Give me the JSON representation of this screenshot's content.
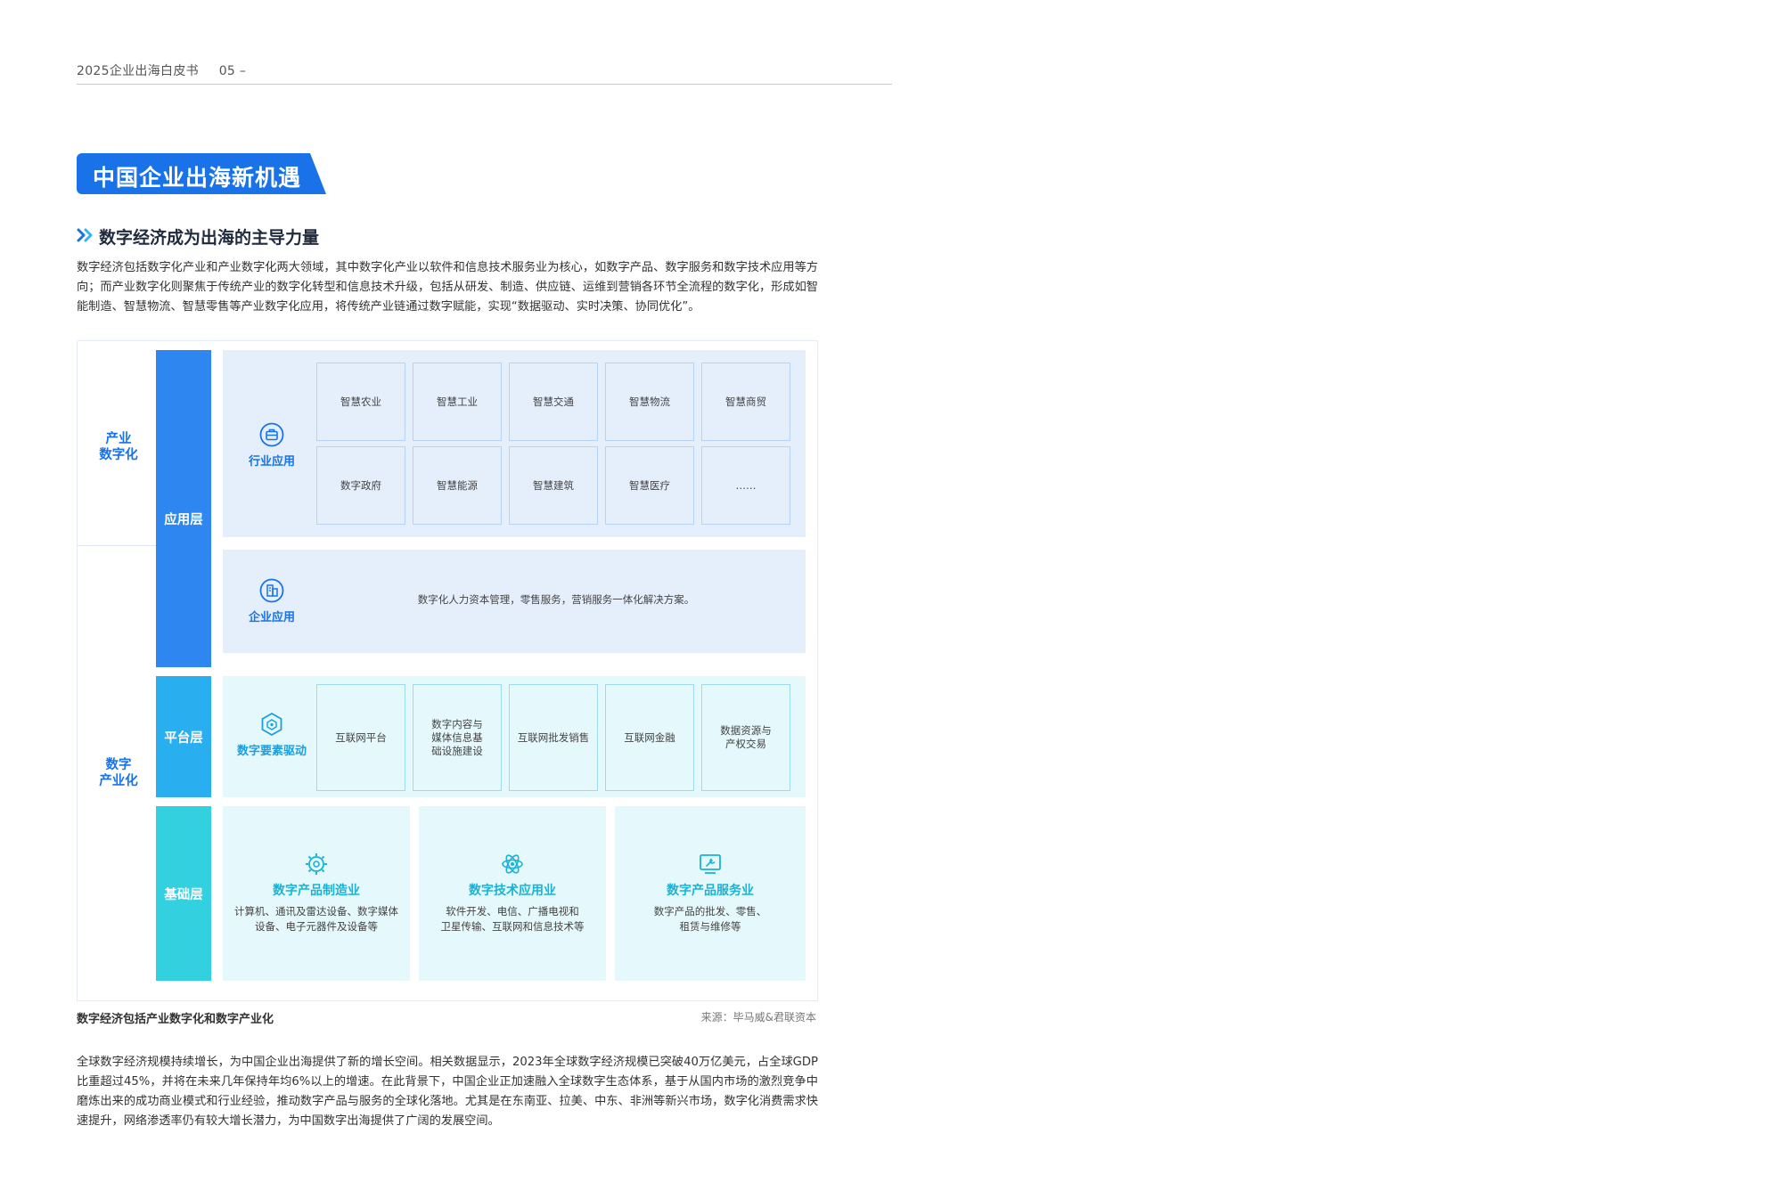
{
  "header": {
    "doc_title": "2025企业出海白皮书",
    "page_number": "05 –"
  },
  "section_title": "中国企业出海新机遇",
  "subsection_title": "数字经济成为出海的主导力量",
  "intro_paragraph": "数字经济包括数字化产业和产业数字化两大领域，其中数字化产业以软件和信息技术服务业为核心，如数字产品、数字服务和数字技术应用等方向；而产业数字化则聚焦于传统产业的数字化转型和信息技术升级，包括从研发、制造、供应链、运维到营销各环节全流程的数字化，形成如智能制造、智慧物流、智慧零售等产业数字化应用，将传统产业链通过数字赋能，实现“数据驱动、实时决策、协同优化”。",
  "diagram": {
    "categories": {
      "industry_digital": "产业\n数字化",
      "digital_industry": "数字\n产业化"
    },
    "layers": {
      "application": "应用层",
      "platform": "平台层",
      "foundation": "基础层"
    },
    "industry_app": {
      "label": "行业应用",
      "items": [
        "智慧农业",
        "智慧工业",
        "智慧交通",
        "智慧物流",
        "智慧商贸",
        "数字政府",
        "智慧能源",
        "智慧建筑",
        "智慧医疗",
        "……"
      ]
    },
    "enterprise_app": {
      "label": "企业应用",
      "description": "数字化人力资本管理，零售服务，营销服务一体化解决方案。"
    },
    "platform": {
      "label": "数字要素驱动",
      "items": [
        "互联网平台",
        "数字内容与\n媒体信息基\n础设施建设",
        "互联网批发销售",
        "互联网金融",
        "数据资源与\n产权交易"
      ]
    },
    "foundation": [
      {
        "title": "数字产品制造业",
        "desc": "计算机、通讯及雷达设备、数字媒体\n设备、电子元器件及设备等",
        "icon": "gear-chip-icon"
      },
      {
        "title": "数字技术应用业",
        "desc": "软件开发、电信、广播电视和\n卫星传输、互联网和信息技术等",
        "icon": "atom-icon"
      },
      {
        "title": "数字产品服务业",
        "desc": "数字产品的批发、零售、\n租赁与维修等",
        "icon": "wrench-monitor-icon"
      }
    ]
  },
  "caption": {
    "left": "数字经济包括产业数字化和数字产业化",
    "source": "来源：毕马威&君联资本"
  },
  "closing_paragraph": "全球数字经济规模持续增长，为中国企业出海提供了新的增长空间。相关数据显示，2023年全球数字经济规模已突破40万亿美元，占全球GDP比重超过45%，并将在未来几年保持年均6%以上的增速。在此背景下，中国企业正加速融入全球数字生态体系，基于从国内市场的激烈竞争中磨炼出来的成功商业模式和行业经验，推动数字产品与服务的全球化落地。尤其是在东南亚、拉美、中东、非洲等新兴市场，数字化消费需求快速提升，网络渗透率仍有较大增长潜力，为中国数字出海提供了广阔的发展空间。",
  "colors": {
    "primary_blue": "#1a72e8",
    "layer_app": "#2e86f0",
    "layer_platform": "#29aef0",
    "layer_base": "#33d0e0",
    "cyan_text": "#19b3d6"
  }
}
